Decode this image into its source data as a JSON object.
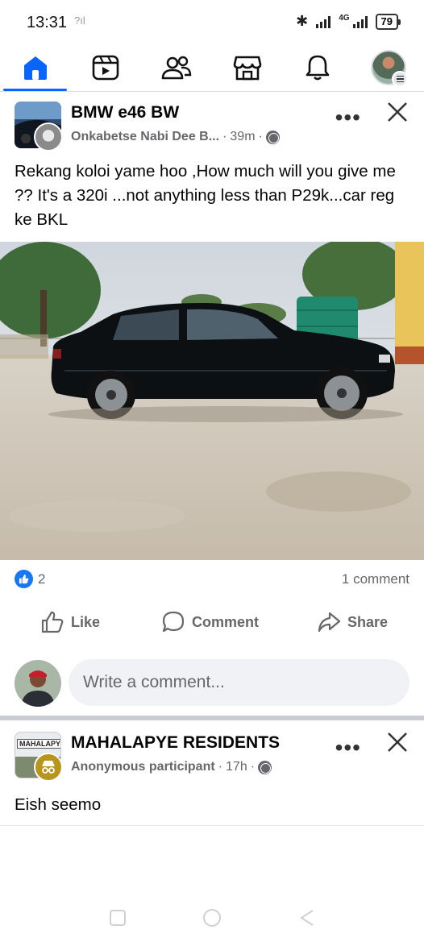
{
  "status_bar": {
    "time": "13:31",
    "sim_indicator": "?ıl",
    "network": "4G",
    "battery": "79"
  },
  "nav": {
    "items": [
      {
        "name": "home",
        "icon": "home-icon",
        "active": true
      },
      {
        "name": "video",
        "icon": "video-icon",
        "active": false
      },
      {
        "name": "friends",
        "icon": "friends-icon",
        "active": false
      },
      {
        "name": "marketplace",
        "icon": "marketplace-icon",
        "active": false
      },
      {
        "name": "notifications",
        "icon": "bell-icon",
        "active": false
      },
      {
        "name": "profile-menu",
        "icon": "avatar",
        "active": false
      }
    ],
    "accent": "#0866ff"
  },
  "post1": {
    "group_name": "BMW e46 BW",
    "author": "Onkabetse Nabi Dee B...",
    "time": "39m",
    "text": "Rekang koloi yame hoo ,How much will you give me ??  It's a 320i ...not anything less than P29k...car reg ke BKL",
    "reaction_count": "2",
    "comment_count": "1 comment"
  },
  "actions": {
    "like": "Like",
    "comment": "Comment",
    "share": "Share"
  },
  "comment_box": {
    "placeholder": "Write a comment..."
  },
  "post2": {
    "group_name": "MAHALAPYE RESIDENTS",
    "group_thumb_text": "MAHALAPYE",
    "author": "Anonymous participant",
    "time": "17h",
    "text": "Eish seemo"
  },
  "colors": {
    "brand": "#0866ff",
    "like_blue": "#1877f2",
    "secondary_text": "#65676b",
    "comment_bg": "#f0f2f5"
  }
}
